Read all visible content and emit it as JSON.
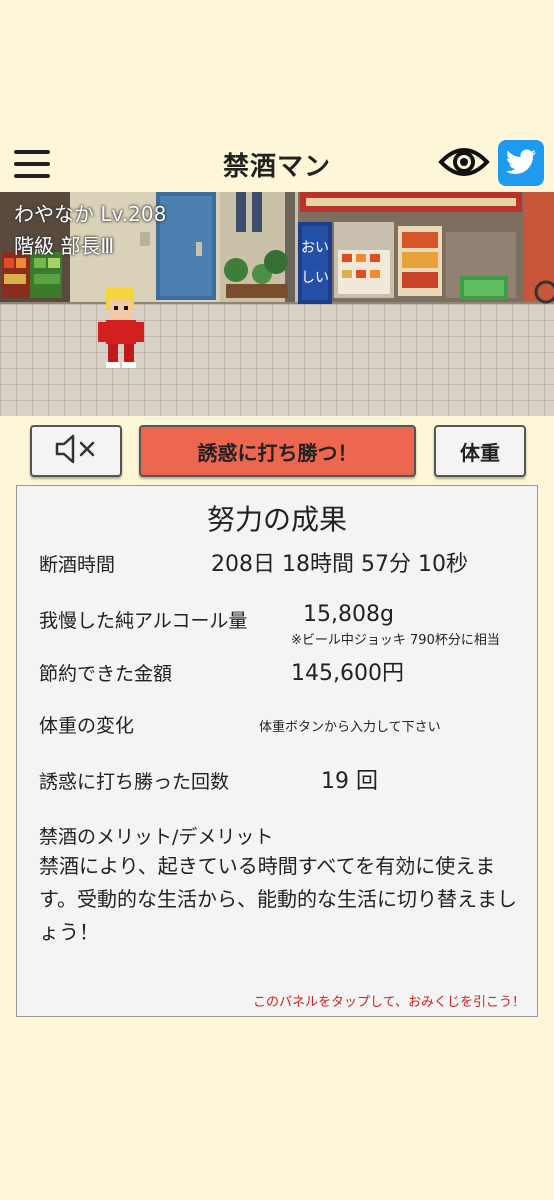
{
  "header": {
    "title": "禁酒マン"
  },
  "player": {
    "name_level": "わやなか Lv.208",
    "rank": "階級 部長Ⅲ"
  },
  "buttons": {
    "mute_label": "",
    "tempt_label": "誘惑に打ち勝つ！",
    "weight_label": "体重"
  },
  "panel": {
    "title": "努力の成果",
    "abstinence_label": "断酒時間",
    "abstinence_value": "208日 18時間 57分 10秒",
    "alcohol_label": "我慢した純アルコール量",
    "alcohol_value": "15,808g",
    "alcohol_note": "※ビール中ジョッキ 790杯分に相当",
    "savings_label": "節約できた金額",
    "savings_value": "145,600円",
    "weight_label": "体重の変化",
    "weight_value": "体重ボタンから入力して下さい",
    "temptation_label": "誘惑に打ち勝った回数",
    "temptation_value": "19 回",
    "merit_title": "禁酒のメリット/デメリット",
    "merit_text": "禁酒により、起きている時間すべてを有効に使えます。受動的な生活から、能動的な生活に切り替えましょう！",
    "omikuji_hint": "このパネルをタップして、おみくじを引こう！"
  },
  "shop_sign": "おいしい",
  "colors": {
    "background": "#fef6d8",
    "accent_button": "#ec6650",
    "twitter": "#1d9bf0",
    "hint_red": "#d61e1e"
  },
  "icons": [
    "menu-icon",
    "eye-icon",
    "twitter-icon",
    "speaker-mute-icon"
  ]
}
